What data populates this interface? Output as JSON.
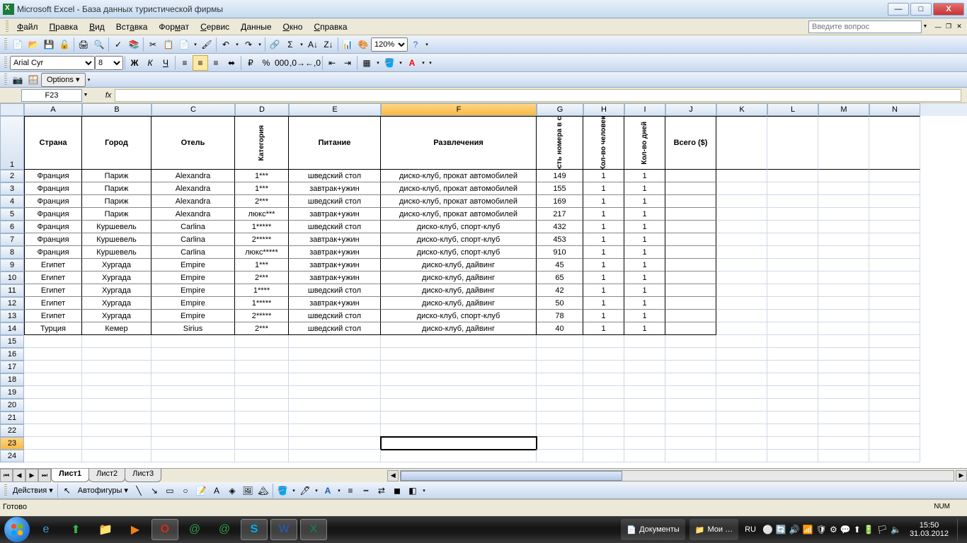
{
  "window": {
    "title": "Microsoft Excel - База данных туристической фирмы",
    "min": "—",
    "max": "□",
    "close": "X"
  },
  "menu": {
    "file": "Файл",
    "edit": "Правка",
    "view": "Вид",
    "insert": "Вставка",
    "format": "Формат",
    "tools": "Сервис",
    "data": "Данные",
    "window": "Окно",
    "help": "Справка",
    "question_placeholder": "Введите вопрос"
  },
  "toolbar": {
    "zoom": "120%",
    "font": "Arial Cyr",
    "font_size": "8",
    "options": "Options"
  },
  "formula": {
    "name_box": "F23",
    "fx": "fx"
  },
  "columns": [
    "A",
    "B",
    "C",
    "D",
    "E",
    "F",
    "G",
    "H",
    "I",
    "J",
    "K",
    "L",
    "M",
    "N"
  ],
  "selected_cell": "F23",
  "headers": {
    "A": "Страна",
    "B": "Город",
    "C": "Отель",
    "D": "Категория",
    "E": "Питание",
    "F": "Развлечения",
    "G": "Стоимость номера в сутки ($)",
    "H": "Кол-во человек",
    "I": "Кол-во дней",
    "J": "Всего ($)"
  },
  "rows": [
    {
      "n": 2,
      "A": "Франция",
      "B": "Париж",
      "C": "Alexandra",
      "D": "1***",
      "E": "шведский стол",
      "F": "диско-клуб, прокат автомобилей",
      "G": "149",
      "H": "1",
      "I": "1",
      "J": ""
    },
    {
      "n": 3,
      "A": "Франция",
      "B": "Париж",
      "C": "Alexandra",
      "D": "1***",
      "E": "завтрак+ужин",
      "F": "диско-клуб, прокат автомобилей",
      "G": "155",
      "H": "1",
      "I": "1",
      "J": ""
    },
    {
      "n": 4,
      "A": "Франция",
      "B": "Париж",
      "C": "Alexandra",
      "D": "2***",
      "E": "шведский стол",
      "F": "диско-клуб, прокат автомобилей",
      "G": "169",
      "H": "1",
      "I": "1",
      "J": ""
    },
    {
      "n": 5,
      "A": "Франция",
      "B": "Париж",
      "C": "Alexandra",
      "D": "люкс***",
      "E": "завтрак+ужин",
      "F": "диско-клуб, прокат автомобилей",
      "G": "217",
      "H": "1",
      "I": "1",
      "J": ""
    },
    {
      "n": 6,
      "A": "Франция",
      "B": "Куршевель",
      "C": "Carlina",
      "D": "1*****",
      "E": "шведский стол",
      "F": "диско-клуб, спорт-клуб",
      "G": "432",
      "H": "1",
      "I": "1",
      "J": ""
    },
    {
      "n": 7,
      "A": "Франция",
      "B": "Куршевель",
      "C": "Carlina",
      "D": "2*****",
      "E": "завтрак+ужин",
      "F": "диско-клуб, спорт-клуб",
      "G": "453",
      "H": "1",
      "I": "1",
      "J": ""
    },
    {
      "n": 8,
      "A": "Франция",
      "B": "Куршевель",
      "C": "Carlina",
      "D": "люкс*****",
      "E": "завтрак+ужин",
      "F": "диско-клуб, спорт-клуб",
      "G": "910",
      "H": "1",
      "I": "1",
      "J": ""
    },
    {
      "n": 9,
      "A": "Египет",
      "B": "Хургада",
      "C": "Empire",
      "D": "1***",
      "E": "завтрак+ужин",
      "F": "диско-клуб, дайвинг",
      "G": "45",
      "H": "1",
      "I": "1",
      "J": ""
    },
    {
      "n": 10,
      "A": "Египет",
      "B": "Хургада",
      "C": "Empire",
      "D": "2***",
      "E": "завтрак+ужин",
      "F": "диско-клуб, дайвинг",
      "G": "65",
      "H": "1",
      "I": "1",
      "J": ""
    },
    {
      "n": 11,
      "A": "Египет",
      "B": "Хургада",
      "C": "Empire",
      "D": "1****",
      "E": "шведский стол",
      "F": "диско-клуб, дайвинг",
      "G": "42",
      "H": "1",
      "I": "1",
      "J": ""
    },
    {
      "n": 12,
      "A": "Египет",
      "B": "Хургада",
      "C": "Empire",
      "D": "1*****",
      "E": "завтрак+ужин",
      "F": "диско-клуб, дайвинг",
      "G": "50",
      "H": "1",
      "I": "1",
      "J": ""
    },
    {
      "n": 13,
      "A": "Египет",
      "B": "Хургада",
      "C": "Empire",
      "D": "2*****",
      "E": "шведский стол",
      "F": "диско-клуб, спорт-клуб",
      "G": "78",
      "H": "1",
      "I": "1",
      "J": ""
    },
    {
      "n": 14,
      "A": "Турция",
      "B": "Кемер",
      "C": "Sirius",
      "D": "2***",
      "E": "шведский стол",
      "F": "диско-клуб, дайвинг",
      "G": "40",
      "H": "1",
      "I": "1",
      "J": ""
    }
  ],
  "empty_rows": [
    15,
    16,
    17,
    18,
    19,
    20,
    21,
    22,
    23,
    24
  ],
  "sheets": {
    "s1": "Лист1",
    "s2": "Лист2",
    "s3": "Лист3"
  },
  "drawing": {
    "actions": "Действия",
    "autoshapes": "Автофигуры"
  },
  "status": {
    "ready": "Готово",
    "num": "NUM"
  },
  "taskbar": {
    "documents": "Документы",
    "my": "Мои …",
    "lang": "RU",
    "time": "15:50",
    "date": "31.03.2012"
  }
}
